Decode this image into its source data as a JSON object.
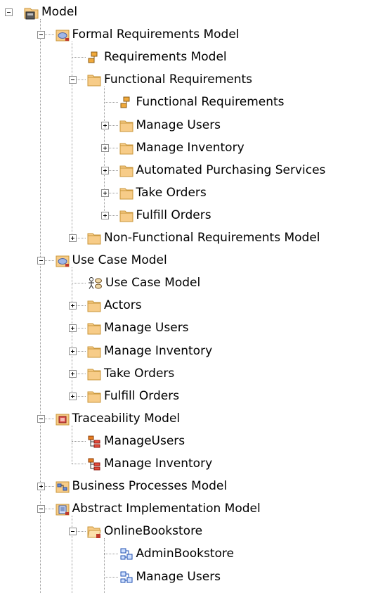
{
  "colors": {
    "folder": "#f7cc88",
    "folder_edge": "#c9963a",
    "model_blue": "#9fb6e6",
    "trace_red": "#d9534f",
    "line": "#9a9a9a"
  },
  "tree": [
    {
      "level": 0,
      "label": "Model",
      "icon": "root-model-icon",
      "expander": "expanded",
      "last": true
    },
    {
      "level": 1,
      "label": "Formal Requirements Model",
      "icon": "package-model-icon",
      "expander": "expanded",
      "last": false
    },
    {
      "level": 2,
      "label": "Requirements Model",
      "icon": "requirements-diagram-icon",
      "expander": "none",
      "last": false
    },
    {
      "level": 2,
      "label": "Functional Requirements",
      "icon": "folder-icon",
      "expander": "expanded",
      "last": false
    },
    {
      "level": 3,
      "label": "Functional Requirements",
      "icon": "requirements-diagram-icon",
      "expander": "none",
      "last": false
    },
    {
      "level": 3,
      "label": "Manage Users",
      "icon": "folder-icon",
      "expander": "collapsed",
      "last": false
    },
    {
      "level": 3,
      "label": "Manage Inventory",
      "icon": "folder-icon",
      "expander": "collapsed",
      "last": false
    },
    {
      "level": 3,
      "label": "Automated Purchasing Services",
      "icon": "folder-icon",
      "expander": "collapsed",
      "last": false
    },
    {
      "level": 3,
      "label": "Take Orders",
      "icon": "folder-icon",
      "expander": "collapsed",
      "last": false
    },
    {
      "level": 3,
      "label": "Fulfill Orders",
      "icon": "folder-icon",
      "expander": "collapsed",
      "last": true
    },
    {
      "level": 2,
      "label": "Non-Functional Requirements Model",
      "icon": "folder-icon",
      "expander": "collapsed",
      "last": true
    },
    {
      "level": 1,
      "label": "Use Case Model",
      "icon": "package-model-icon",
      "expander": "expanded",
      "last": false
    },
    {
      "level": 2,
      "label": "Use Case Model",
      "icon": "use-case-diagram-icon",
      "expander": "none",
      "last": false
    },
    {
      "level": 2,
      "label": "Actors",
      "icon": "folder-icon",
      "expander": "collapsed",
      "last": false
    },
    {
      "level": 2,
      "label": "Manage Users",
      "icon": "folder-icon",
      "expander": "collapsed",
      "last": false
    },
    {
      "level": 2,
      "label": "Manage Inventory",
      "icon": "folder-icon",
      "expander": "collapsed",
      "last": false
    },
    {
      "level": 2,
      "label": "Take Orders",
      "icon": "folder-icon",
      "expander": "collapsed",
      "last": false
    },
    {
      "level": 2,
      "label": "Fulfill Orders",
      "icon": "folder-icon",
      "expander": "collapsed",
      "last": true
    },
    {
      "level": 1,
      "label": "Traceability Model",
      "icon": "traceability-model-icon",
      "expander": "expanded",
      "last": false
    },
    {
      "level": 2,
      "label": "ManageUsers",
      "icon": "traceability-diagram-icon",
      "expander": "none",
      "last": false
    },
    {
      "level": 2,
      "label": "Manage Inventory",
      "icon": "traceability-diagram-icon",
      "expander": "none",
      "last": true
    },
    {
      "level": 1,
      "label": "Business Processes Model",
      "icon": "business-process-model-icon",
      "expander": "collapsed",
      "last": false
    },
    {
      "level": 1,
      "label": "Abstract Implementation Model",
      "icon": "implementation-model-icon",
      "expander": "expanded",
      "last": false
    },
    {
      "level": 2,
      "label": "OnlineBookstore",
      "icon": "open-folder-icon",
      "expander": "expanded",
      "last": false
    },
    {
      "level": 3,
      "label": "AdminBookstore",
      "icon": "class-diagram-icon",
      "expander": "none",
      "last": false
    },
    {
      "level": 3,
      "label": "Manage Users",
      "icon": "class-diagram-icon",
      "expander": "none",
      "last": false
    }
  ]
}
